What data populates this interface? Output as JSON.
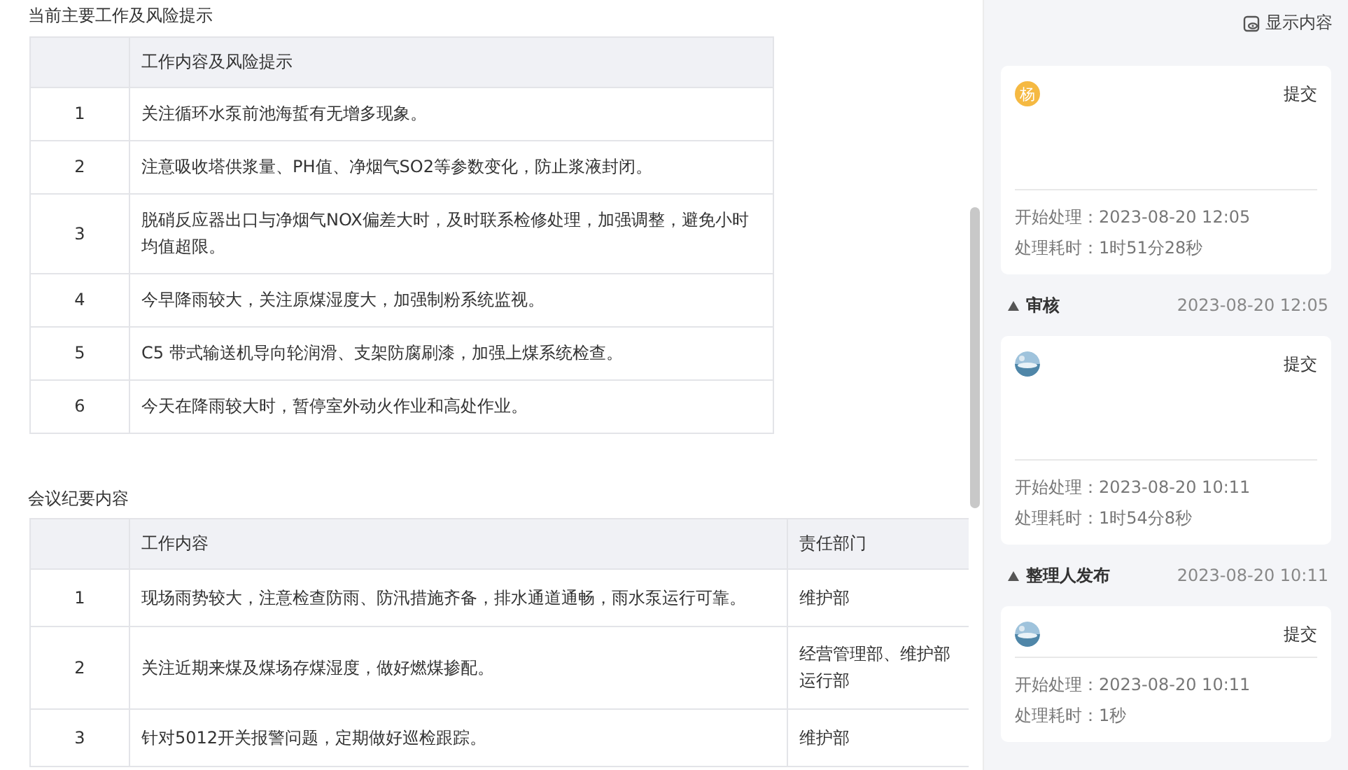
{
  "risk_section": {
    "title": "当前主要工作及风险提示",
    "header": "工作内容及风险提示",
    "rows": [
      {
        "index": "1",
        "text": "关注循环水泵前池海蜇有无增多现象。"
      },
      {
        "index": "2",
        "text": "注意吸收塔供浆量、PH值、净烟气SO2等参数变化，防止浆液封闭。"
      },
      {
        "index": "3",
        "text": "脱硝反应器出口与净烟气NOX偏差大时，及时联系检修处理，加强调整，避免小时均值超限。"
      },
      {
        "index": "4",
        "text": "今早降雨较大，关注原煤湿度大，加强制粉系统监视。"
      },
      {
        "index": "5",
        "text": "C5 带式输送机导向轮润滑、支架防腐刷漆，加强上煤系统检查。"
      },
      {
        "index": "6",
        "text": "今天在降雨较大时，暂停室外动火作业和高处作业。"
      }
    ]
  },
  "meeting_section": {
    "title": "会议纪要内容",
    "columns": [
      "工作内容",
      "责任部门"
    ],
    "rows": [
      {
        "index": "1",
        "content": "现场雨势较大，注意检查防雨、防汛措施齐备，排水通道通畅，雨水泵运行可靠。",
        "department": "维护部"
      },
      {
        "index": "2",
        "content": "关注近期来煤及煤场存煤湿度，做好燃煤掺配。",
        "department": "经营管理部、维护部运行部"
      },
      {
        "index": "3",
        "content": "针对5012开关报警问题，定期做好巡检跟踪。",
        "department": "维护部"
      }
    ]
  },
  "sidebar": {
    "show_content_button": "显示内容",
    "records": [
      {
        "card": {
          "kind": "with_note",
          "avatar": {
            "kind": "letter",
            "text": "杨"
          },
          "action": "提交",
          "start": "开始处理：2023-08-20 12:05",
          "duration": "处理耗时：1时51分28秒"
        }
      },
      {
        "section": {
          "title": "审核",
          "time": "2023-08-20 12:05"
        },
        "card": {
          "kind": "with_note",
          "action": "提交",
          "start": "开始处理：2023-08-20 10:11",
          "duration": "处理耗时：1时54分8秒"
        }
      },
      {
        "section": {
          "title": "整理人发布",
          "time": "2023-08-20 10:11"
        },
        "card": {
          "kind": "plain",
          "action": "提交",
          "start": "开始处理：2023-08-20 10:11",
          "duration": "处理耗时：1秒"
        }
      }
    ]
  }
}
